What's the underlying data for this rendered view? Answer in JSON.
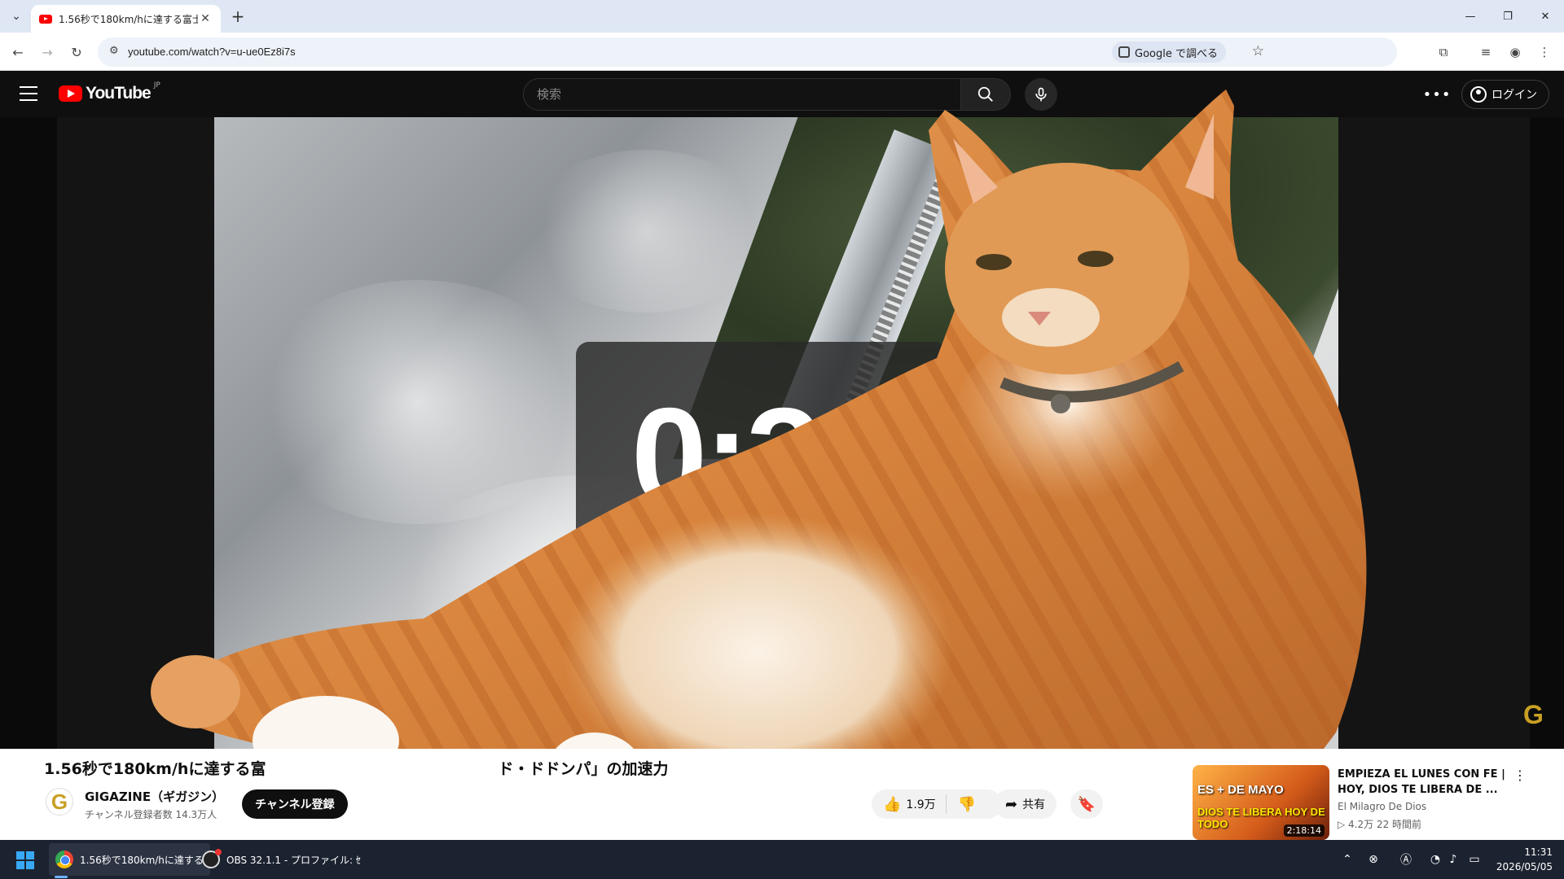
{
  "browser": {
    "tab_title": "1.56秒で180km/hに達する富士急",
    "tab_close": "✕",
    "new_tab": "+",
    "url": "youtube.com/watch?v=u-ue0Ez8i7s",
    "lens_label": "Google で調べる"
  },
  "youtube": {
    "logo_text": "YouTube",
    "region": "JP",
    "search_placeholder": "検索",
    "login_label": "ログイン"
  },
  "player": {
    "timer": "0:32",
    "watermark": "G"
  },
  "video": {
    "title": "1.56秒で180km/hに達する富　　　　　　　　　　　　　　　ド・ドドンパ」の加速力",
    "channel_name": "GIGAZINE（ギガジン）",
    "channel_subs": "チャンネル登録者数 14.3万人",
    "channel_avatar": "G",
    "subscribe_label": "チャンネル登録",
    "like_count": "1.9万",
    "share_label": "共有"
  },
  "recommended": {
    "title": "EMPIEZA EL LUNES CON FE | HOY, DIOS TE LIBERA DE ...",
    "channel": "El Milagro De Dios",
    "meta": "▷ 4.2万  22 時間前",
    "duration": "2:18:14",
    "thumb_line1": "ES + DE MAYO",
    "thumb_line2": "DIOS TE LIBERA HOY DE TODO"
  },
  "taskbar": {
    "chrome_label": "1.56秒で180km/hに達する",
    "obs_label": "OBS 32.1.1 - プロファイル: ｾ",
    "time": "11:31",
    "date": "2026/05/05"
  },
  "colors": {
    "yt_red": "#ff0000",
    "chrome_tabbar": "#dfe7f5",
    "taskbar": "#1c2330",
    "cat_orange": "#e0914a"
  },
  "icons": {
    "back": "arrow-left-icon",
    "forward": "arrow-right-icon",
    "reload": "reload-icon",
    "search": "search-icon",
    "mic": "microphone-icon",
    "like": "thumbs-up-icon",
    "dislike": "thumbs-down-icon",
    "share": "share-icon",
    "save": "bookmark-icon"
  }
}
